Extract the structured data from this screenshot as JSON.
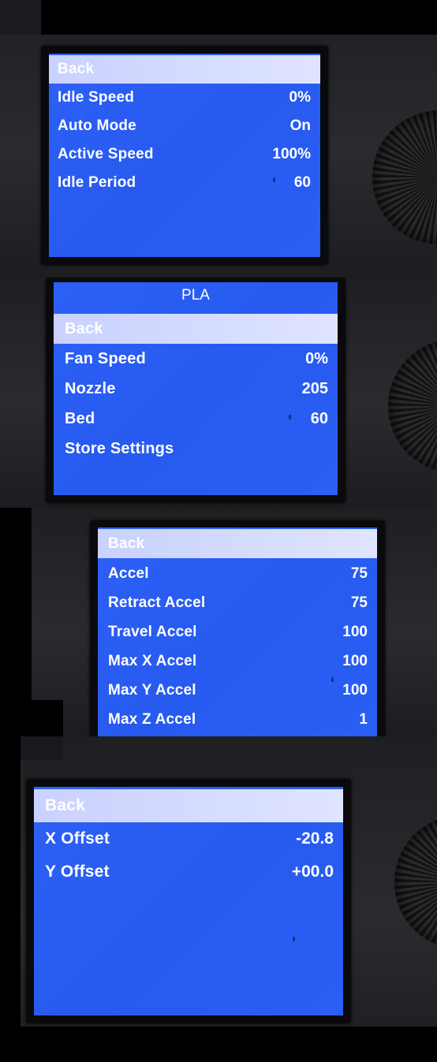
{
  "screens": [
    {
      "title": "",
      "rows": [
        {
          "label": "Back",
          "value": "",
          "selected": true
        },
        {
          "label": "Idle Speed",
          "value": "0%"
        },
        {
          "label": "Auto Mode",
          "value": "On"
        },
        {
          "label": "Active Speed",
          "value": "100%"
        },
        {
          "label": "Idle Period",
          "value": "60"
        }
      ]
    },
    {
      "title": "PLA",
      "rows": [
        {
          "label": "Back",
          "value": "",
          "selected": true
        },
        {
          "label": "Fan Speed",
          "value": "0%"
        },
        {
          "label": "Nozzle",
          "value": "205"
        },
        {
          "label": "Bed",
          "value": "60"
        },
        {
          "label": "Store Settings",
          "value": ""
        }
      ]
    },
    {
      "title": "",
      "rows": [
        {
          "label": "Back",
          "value": "",
          "selected": true
        },
        {
          "label": "Accel",
          "value": "75"
        },
        {
          "label": "Retract Accel",
          "value": "75"
        },
        {
          "label": "Travel Accel",
          "value": "100"
        },
        {
          "label": "Max X Accel",
          "value": "100"
        },
        {
          "label": "Max Y Accel",
          "value": "100"
        },
        {
          "label": "Max Z Accel",
          "value": "1"
        }
      ]
    },
    {
      "title": "",
      "rows": [
        {
          "label": "Back",
          "value": "",
          "selected": true
        },
        {
          "label": "X Offset",
          "value": "-20.8"
        },
        {
          "label": "Y Offset",
          "value": "+00.0"
        }
      ]
    }
  ]
}
